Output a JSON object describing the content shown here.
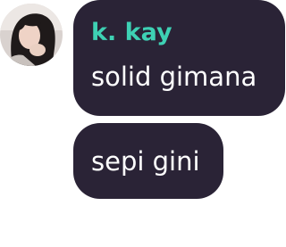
{
  "messages": [
    {
      "sender": "k. kay",
      "text": "solid gimana"
    },
    {
      "text": "sepi gini"
    }
  ],
  "colors": {
    "bubble_background": "#2a2336",
    "sender_name": "#3ed1b4",
    "message_text": "#ffffff"
  }
}
